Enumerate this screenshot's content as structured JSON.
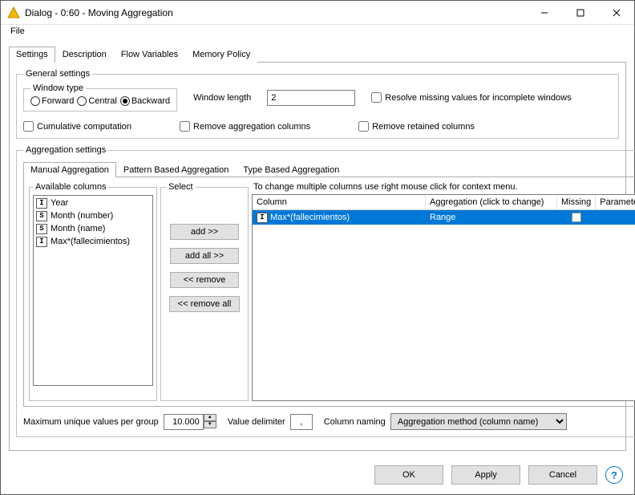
{
  "window": {
    "title": "Dialog - 0:60 - Moving Aggregation"
  },
  "menu": {
    "file": "File"
  },
  "tabs": {
    "settings": "Settings",
    "description": "Description",
    "flow_variables": "Flow Variables",
    "memory_policy": "Memory Policy"
  },
  "general": {
    "legend": "General settings",
    "window_type": {
      "legend": "Window type",
      "forward": "Forward",
      "central": "Central",
      "backward": "Backward",
      "selected": "backward"
    },
    "window_length_label": "Window length",
    "window_length_value": "2",
    "resolve_missing": "Resolve missing values for incomplete windows",
    "cumulative": "Cumulative computation",
    "remove_agg": "Remove aggregation columns",
    "remove_retained": "Remove retained columns"
  },
  "agg": {
    "legend": "Aggregation settings",
    "tabs": {
      "manual": "Manual Aggregation",
      "pattern": "Pattern Based Aggregation",
      "type": "Type Based Aggregation"
    },
    "available_legend": "Available columns",
    "select_legend": "Select",
    "buttons": {
      "add": "add >>",
      "add_all": "add all >>",
      "remove": "<< remove",
      "remove_all": "<< remove all"
    },
    "available_columns": [
      {
        "type": "I",
        "name": "Year"
      },
      {
        "type": "S",
        "name": "Month (number)"
      },
      {
        "type": "S",
        "name": "Month (name)"
      },
      {
        "type": "I",
        "name": "Max*(fallecimientos)"
      }
    ],
    "hint": "To change multiple columns use right mouse click for context menu.",
    "headers": {
      "column": "Column",
      "aggregation": "Aggregation (click to change)",
      "missing": "Missing",
      "parameter": "Parameter"
    },
    "rows": [
      {
        "type": "I",
        "column": "Max*(fallecimientos)",
        "aggregation": "Range",
        "missing": false,
        "parameter": ""
      }
    ]
  },
  "bottom": {
    "max_unique_label": "Maximum unique values per group",
    "max_unique_value": "10.000",
    "value_delim_label": "Value delimiter",
    "value_delim_value": ",",
    "col_naming_label": "Column naming",
    "col_naming_value": "Aggregation method (column name)"
  },
  "footer": {
    "ok": "OK",
    "apply": "Apply",
    "cancel": "Cancel"
  }
}
